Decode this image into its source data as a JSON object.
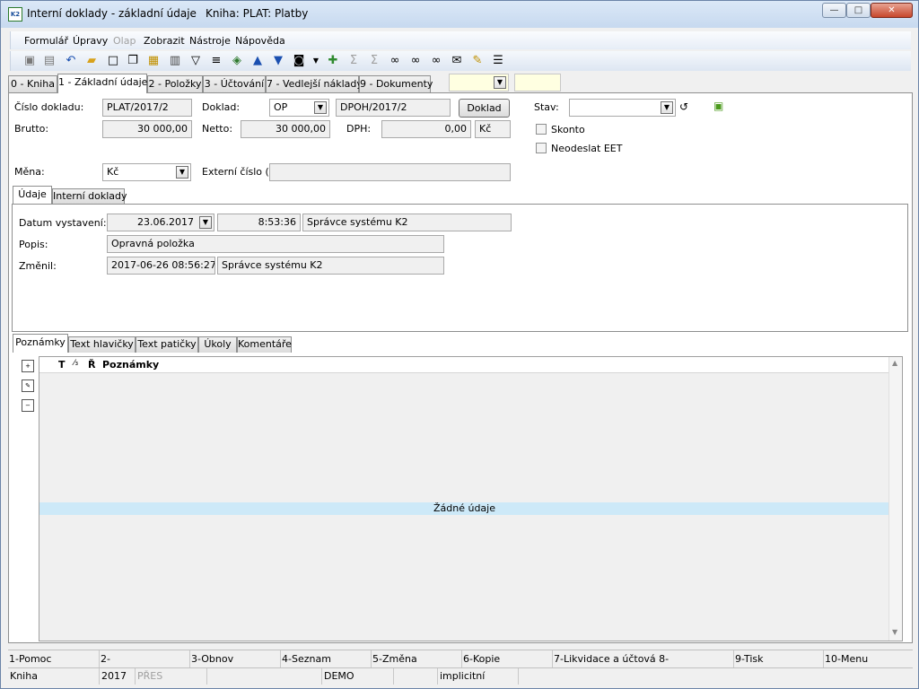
{
  "window": {
    "title": "Interní doklady - základní údaje",
    "book": "Kniha: PLAT: Platby",
    "icon_text": "K2",
    "minimize": "—",
    "maximize": "□",
    "close": "✕"
  },
  "menu": {
    "formular": "Formulář",
    "upravy": "Úpravy",
    "olap": "Olap",
    "zobrazit": "Zobrazit",
    "nastroje": "Nástroje",
    "napoveda": "Nápověda"
  },
  "toolbar": {
    "icons": [
      "save-icon",
      "save-as-icon",
      "undo-icon",
      "open-folder-icon",
      "new-document-icon",
      "copy-document-icon",
      "lock-icon",
      "book-icon",
      "filter-icon",
      "filter-list-icon",
      "stack-icon",
      "arrow-up-icon",
      "arrow-down-icon",
      "camera-icon",
      "arrow-dropdown-icon",
      "green-arrow-icon",
      "sum-icon",
      "sum-special-icon",
      "binoculars-icon",
      "binoculars-next-icon",
      "binoculars-prev-icon",
      "mail-icon",
      "edit-list-icon",
      "menu-icon"
    ]
  },
  "tabs": {
    "t0": "0 - Kniha",
    "t1": "1 - Základní údaje",
    "t2": "2 - Položky",
    "t3": "3 - Účtování",
    "t7": "7 - Vedlejší náklady",
    "t9": "9 - Dokumenty"
  },
  "header": {
    "cislo_label": "Číslo dokladu:",
    "cislo_value": "PLAT/2017/2",
    "doklad_label": "Doklad:",
    "doklad_type": "OP",
    "doklad_ref": "DPOH/2017/2",
    "doklad_button": "Doklad",
    "stav_label": "Stav:",
    "brutto_label": "Brutto:",
    "brutto_value": "30 000,00",
    "netto_label": "Netto:",
    "netto_value": "30 000,00",
    "dph_label": "DPH:",
    "dph_value": "0,00",
    "currency_short": "Kč",
    "skonto_label": "Skonto",
    "eet_label": "Neodeslat EET",
    "mena_label": "Měna:",
    "mena_value": "Kč",
    "externi_label": "Externí číslo (i):"
  },
  "subtabs": {
    "udaje": "Údaje",
    "interni": "Interní doklady"
  },
  "details": {
    "datum_label": "Datum vystavení:",
    "datum_value": "23.06.2017",
    "time_value": "8:53:36",
    "user_value": "Správce systému K2",
    "popis_label": "Popis:",
    "popis_value": "Opravná položka",
    "zmenil_label": "Změnil:",
    "zmenil_date": "2017-06-26 08:56:27",
    "zmenil_user": "Správce systému K2"
  },
  "notes_tabs": {
    "poznamky": "Poznámky",
    "hlavicky": "Text hlavičky",
    "paticky": "Text patičky",
    "ukoly": "Úkoly",
    "komentare": "Komentáře"
  },
  "grid": {
    "col_t": "T",
    "col_slash": "⁄₃",
    "col_r": "Ř",
    "col_notes": "Poznámky",
    "empty": "Žádné údaje"
  },
  "fkeys": [
    "1-Pomoc",
    "2-",
    "3-Obnov",
    "4-Seznam",
    "5-Změna",
    "6-Kopie",
    "7-Likvidace a účtová 8-",
    "9-Tisk",
    "10-Menu"
  ],
  "status": {
    "kniha": "Kniha",
    "year": "2017",
    "pres": "PŘES",
    "demo": "DEMO",
    "implicit": "implicitní"
  }
}
